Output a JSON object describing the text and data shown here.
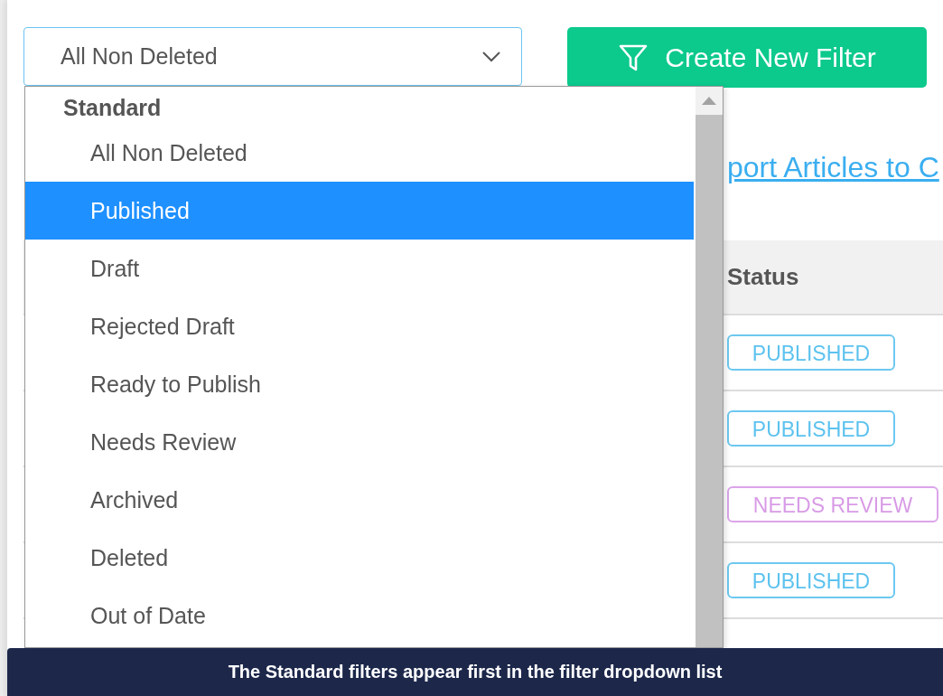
{
  "filter_select": {
    "value": "All Non Deleted"
  },
  "create_button": {
    "label": "Create New Filter"
  },
  "link": {
    "text": "port Articles to C"
  },
  "table": {
    "columns": [
      "Status"
    ],
    "rows": [
      {
        "status": "PUBLISHED",
        "kind": "published"
      },
      {
        "status": "PUBLISHED",
        "kind": "published"
      },
      {
        "status": "NEEDS REVIEW",
        "kind": "review"
      },
      {
        "status": "PUBLISHED",
        "kind": "published"
      }
    ]
  },
  "dropdown": {
    "groups": [
      {
        "label": "Standard",
        "items": [
          {
            "label": "All Non Deleted",
            "selected": false
          },
          {
            "label": "Published",
            "selected": true
          },
          {
            "label": "Draft",
            "selected": false
          },
          {
            "label": "Rejected Draft",
            "selected": false
          },
          {
            "label": "Ready to Publish",
            "selected": false
          },
          {
            "label": "Needs Review",
            "selected": false
          },
          {
            "label": "Archived",
            "selected": false
          },
          {
            "label": "Deleted",
            "selected": false
          },
          {
            "label": "Out of Date",
            "selected": false
          }
        ]
      }
    ]
  },
  "caption": {
    "text": "The Standard filters appear first in the filter dropdown list"
  }
}
